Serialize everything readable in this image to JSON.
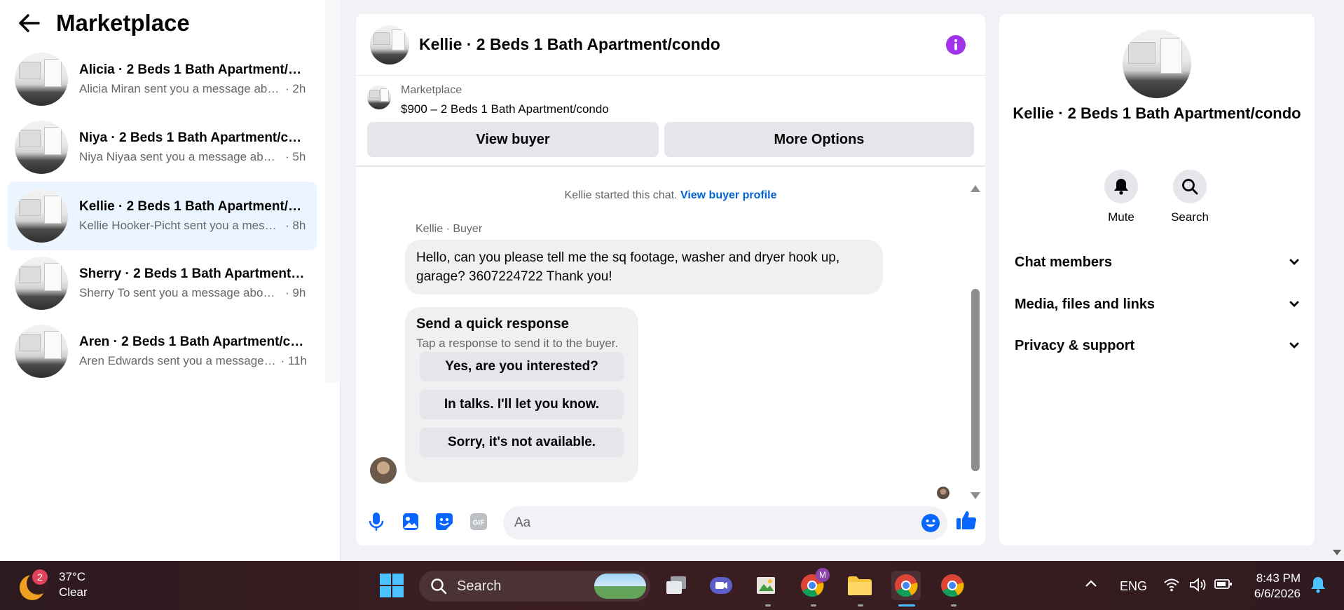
{
  "sidebar": {
    "title": "Marketplace",
    "conversations": [
      {
        "name": "Alicia · 2 Beds 1 Bath Apartment/condo",
        "preview": "Alicia Miran sent you a message about your listing",
        "time": "· 2h"
      },
      {
        "name": "Niya · 2 Beds 1 Bath Apartment/condo",
        "preview": "Niya Niyaa sent you a message about your listing",
        "time": "· 5h"
      },
      {
        "name": "Kellie · 2 Beds 1 Bath Apartment/condo",
        "preview": "Kellie Hooker-Picht sent you a message about your listing",
        "time": "· 8h"
      },
      {
        "name": "Sherry · 2 Beds 1 Bath Apartment/condo",
        "preview": "Sherry To sent you a message about your listing",
        "time": "· 9h"
      },
      {
        "name": "Aren · 2 Beds 1 Bath Apartment/condo",
        "preview": "Aren Edwards sent you a message about your listing",
        "time": "· 11h"
      }
    ]
  },
  "chat": {
    "title": "Kellie · 2 Beds 1 Bath Apartment/condo",
    "listing_source": "Marketplace",
    "listing_price": "$900 – 2 Beds 1 Bath Apartment/condo",
    "view_buyer": "View buyer",
    "more_options": "More Options",
    "started_text": "Kellie started this chat.",
    "view_buyer_profile": "View buyer profile",
    "sender_label": "Kellie · Buyer",
    "message": "Hello, can you please tell me the sq footage, washer and dryer hook up, garage? 3607224722 Thank you!",
    "quick_title": "Send a quick response",
    "quick_sub": "Tap a response to send it to the buyer.",
    "quick_options": [
      "Yes, are you interested?",
      "In talks. I'll let you know.",
      "Sorry, it's not available."
    ],
    "input_placeholder": "Aa",
    "gif_label": "GIF"
  },
  "details": {
    "title": "Kellie · 2 Beds 1 Bath Apartment/condo",
    "mute": "Mute",
    "search": "Search",
    "sections": [
      "Chat members",
      "Media, files and links",
      "Privacy & support"
    ]
  },
  "taskbar": {
    "weather_badge": "2",
    "temperature": "37°C",
    "condition": "Clear",
    "search_label": "Search",
    "lang": "ENG",
    "time": "8:43 PM",
    "date": "6/6/2026",
    "chrome_badge": "M"
  },
  "colors": {
    "accent": "#0866ff",
    "active_row": "#ebf5ff",
    "info": "#a033e8"
  }
}
